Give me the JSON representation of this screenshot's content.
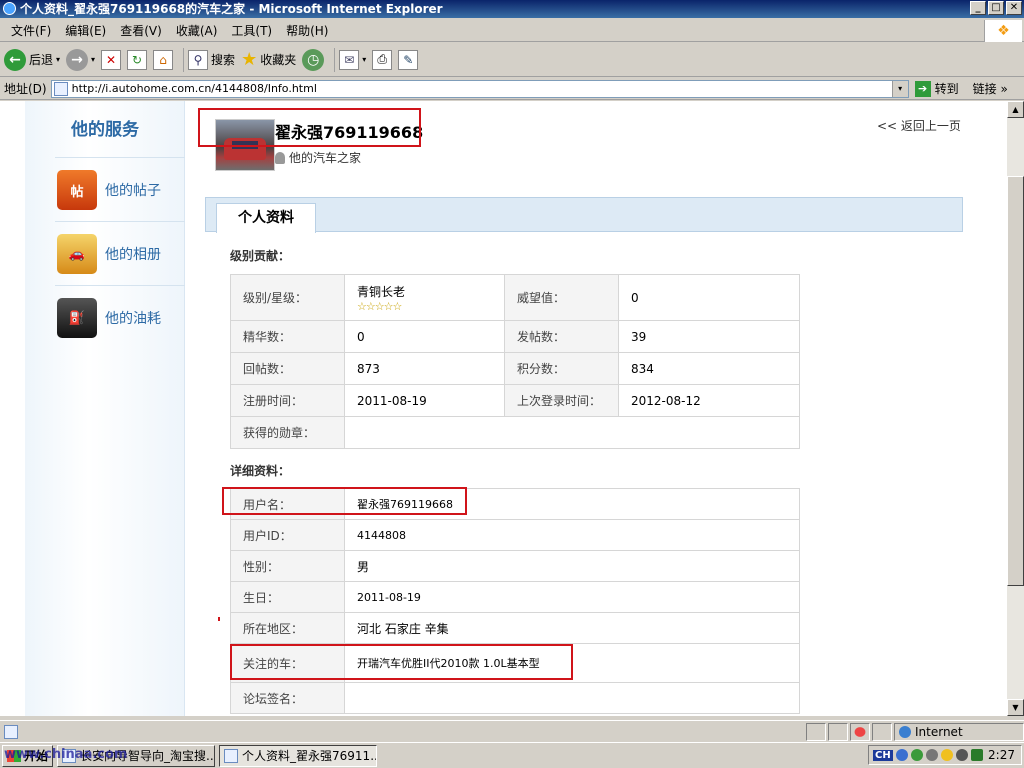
{
  "window": {
    "title": "个人资料_翟永强769119668的汽车之家 - Microsoft Internet Explorer",
    "min": "_",
    "max": "□",
    "close": "✕"
  },
  "menu": [
    "文件(F)",
    "编辑(E)",
    "查看(V)",
    "收藏(A)",
    "工具(T)",
    "帮助(H)"
  ],
  "toolbar": {
    "back": "后退",
    "search": "搜索",
    "favorites": "收藏夹",
    "back_glyph": "←",
    "forward_glyph": "→",
    "dropdown_glyph": "▾",
    "stop_glyph": "✕",
    "refresh_glyph": "↻",
    "home_glyph": "⌂",
    "search_glyph": "⚲",
    "favorites_glyph": "★",
    "history_glyph": "◷",
    "mail_glyph": "✉",
    "print_glyph": "⎙",
    "edit_glyph": "✎"
  },
  "address": {
    "label": "地址(D)",
    "url": "http://i.autohome.com.cn/4144808/Info.html",
    "go": "转到",
    "go_glyph": "➔",
    "links": "链接",
    "expand_glyph": "»"
  },
  "sidebar": {
    "title": "他的服务",
    "items": [
      {
        "label": "他的帖子",
        "icon": "posts-icon",
        "glyph": "帖"
      },
      {
        "label": "他的相册",
        "icon": "album-icon",
        "glyph": "🚗"
      },
      {
        "label": "他的油耗",
        "icon": "fuel-icon",
        "glyph": "⛽"
      }
    ]
  },
  "profile": {
    "name": "翟永强769119668",
    "sub": "他的汽车之家",
    "back_link": "<< 返回上一页"
  },
  "tab": {
    "label": "个人资料"
  },
  "level_section": {
    "title": "级别贡献：",
    "rows": [
      {
        "l1": "级别/星级：",
        "v1": "青铜长老",
        "stars": "☆☆☆☆☆",
        "l2": "威望值：",
        "v2": "0"
      },
      {
        "l1": "精华数：",
        "v1": "0",
        "l2": "发帖数：",
        "v2": "39"
      },
      {
        "l1": "回帖数：",
        "v1": "873",
        "l2": "积分数：",
        "v2": "834"
      },
      {
        "l1": "注册时间：",
        "v1": "2011-08-19",
        "l2": "上次登录时间：",
        "v2": "2012-08-12"
      },
      {
        "l1": "获得的勋章：",
        "v1": ""
      }
    ]
  },
  "detail_section": {
    "title": "详细资料：",
    "rows": [
      {
        "label": "用户名：",
        "value": "翟永强769119668"
      },
      {
        "label": "用户ID：",
        "value": "4144808"
      },
      {
        "label": "性别：",
        "value": "男"
      },
      {
        "label": "生日：",
        "value": "2011-08-19"
      },
      {
        "label": "所在地区：",
        "value": "河北  石家庄  辛集"
      },
      {
        "label": "关注的车：",
        "value": "开瑞汽车优胜II代2010款 1.0L基本型"
      },
      {
        "label": "论坛签名：",
        "value": ""
      }
    ]
  },
  "statusbar": {
    "zone": "Internet"
  },
  "taskbar": {
    "start": "开始",
    "watermark": "www.chinaa.com",
    "tasks": [
      "长安向导智导向_淘宝搜...",
      "个人资料_翟永强76911..."
    ],
    "tray_lang": "CH",
    "clock": "2:27"
  },
  "colors": {
    "highlight_red": "#d0141a",
    "link_blue": "#2d6aa5",
    "tab_bg": "#ddeaf5"
  }
}
